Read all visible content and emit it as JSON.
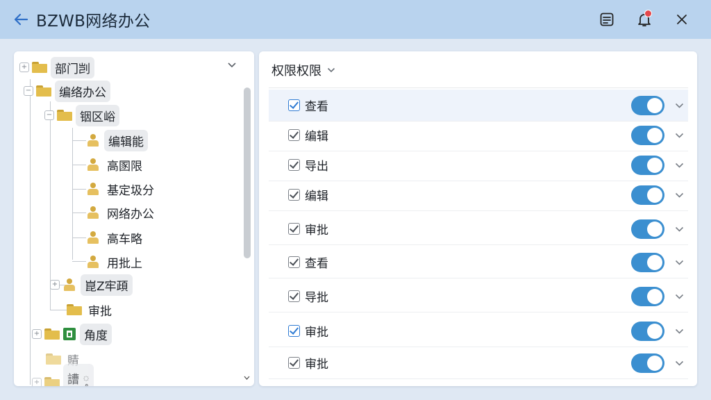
{
  "window": {
    "title": "BZWB网络办公"
  },
  "tree": {
    "root_label": "部门剀",
    "nodes": [
      {
        "label": "编络办公"
      },
      {
        "label": "铟区峪"
      },
      {
        "label": "编辑能"
      },
      {
        "label": "高圂限"
      },
      {
        "label": "基定圾分"
      },
      {
        "label": "网络办公"
      },
      {
        "label": "高车略"
      },
      {
        "label": "用批上"
      },
      {
        "label": "崑Z牢頙"
      },
      {
        "label": "审批"
      },
      {
        "label": "角度"
      },
      {
        "label": "䝼"
      },
      {
        "label": "䜊 ༵"
      }
    ]
  },
  "permissions": {
    "header": "权限权限",
    "rows": [
      {
        "label": "查看",
        "checked": true,
        "enabled": true
      },
      {
        "label": "编辑",
        "checked": true,
        "enabled": true
      },
      {
        "label": "导出",
        "checked": true,
        "enabled": true
      },
      {
        "label": "编辑",
        "checked": true,
        "enabled": true
      },
      {
        "label": "审批",
        "checked": true,
        "enabled": true
      },
      {
        "label": "查看",
        "checked": true,
        "enabled": true
      },
      {
        "label": "导批",
        "checked": true,
        "enabled": true
      },
      {
        "label": "审批",
        "checked": true,
        "enabled": true
      },
      {
        "label": "审批",
        "checked": true,
        "enabled": true
      }
    ]
  },
  "colors": {
    "titlebar": "#b9d3ee",
    "accent": "#3b8fd0",
    "folder": "#e3bd4c"
  },
  "icons": [
    "back-arrow-icon",
    "notes-icon",
    "bell-icon",
    "close-icon",
    "folder-icon",
    "user-icon",
    "role-icon",
    "chevron-down-icon"
  ]
}
